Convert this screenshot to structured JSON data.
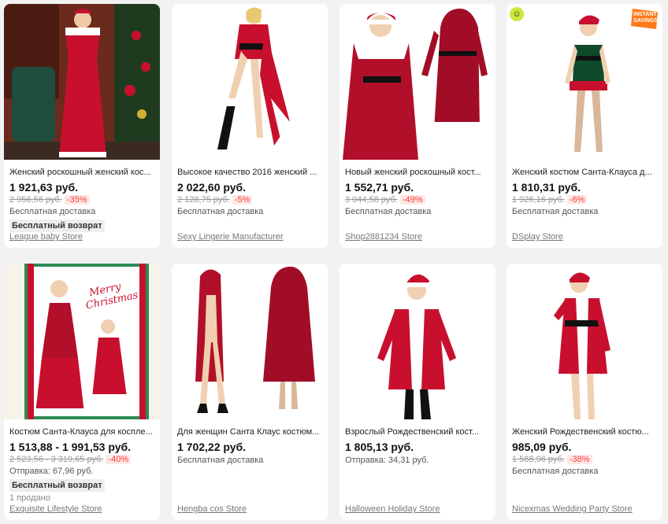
{
  "products": [
    {
      "title": "Женский роскошный женский кос...",
      "price": "1 921,63 руб.",
      "old_price": "2 956,56 руб.",
      "discount": "-35%",
      "shipping": "Бесплатная доставка",
      "badge": "Бесплатный возврат",
      "store": "League baby Store"
    },
    {
      "title": "Высокое качество 2016 женский ...",
      "price": "2 022,60 руб.",
      "old_price": "2 128,75 руб.",
      "discount": "-5%",
      "shipping": "Бесплатная доставка",
      "store": "Sexy Lingerie Manufacturer"
    },
    {
      "title": "Новый женский роскошный кост...",
      "price": "1 552,71 руб.",
      "old_price": "3 044,58 руб.",
      "discount": "-49%",
      "shipping": "Бесплатная доставка",
      "store": "Shop2881234 Store"
    },
    {
      "title": "Женский костюм Санта-Клауса д...",
      "price": "1 810,31 руб.",
      "old_price": "1 926,16 руб.",
      "discount": "-6%",
      "shipping": "Бесплатная доставка",
      "store": "DSplay Store",
      "overlay_badge": "INSTANT SAVINGS"
    },
    {
      "title": "Костюм Санта-Клауса для косплe...",
      "price": "1 513,88 - 1 991,53 руб.",
      "old_price": "2 523,56 - 3 319,65 руб.",
      "discount": "-40%",
      "shipping": "Отправка: 67,96 руб.",
      "badge": "Бесплатный возврат",
      "sold": "1 продано",
      "store": "Exquisite Lifestyle Store",
      "image_text": "Merry Christmas"
    },
    {
      "title": "Для женщин Санта Клаус костюм...",
      "price": "1 702,22 руб.",
      "shipping": "Бесплатная доставка",
      "store": "Hengba cos Store"
    },
    {
      "title": "Взрослый Рождественский кост...",
      "price": "1 805,13 руб.",
      "shipping": "Отправка: 34,31 руб.",
      "store": "Halloween Holiday Store"
    },
    {
      "title": "Женский Рождественский костю...",
      "price": "985,09 руб.",
      "old_price": "1 588,96 руб.",
      "discount": "-38%",
      "shipping": "Бесплатная доставка",
      "store": "Nicexmas Wedding Party Store"
    }
  ],
  "colors": {
    "accent_red": "#c8102e",
    "discount_red": "#ff3b2f",
    "background": "#f2f2f2"
  },
  "icons": {
    "corner_icon": "emoji-face-icon"
  }
}
